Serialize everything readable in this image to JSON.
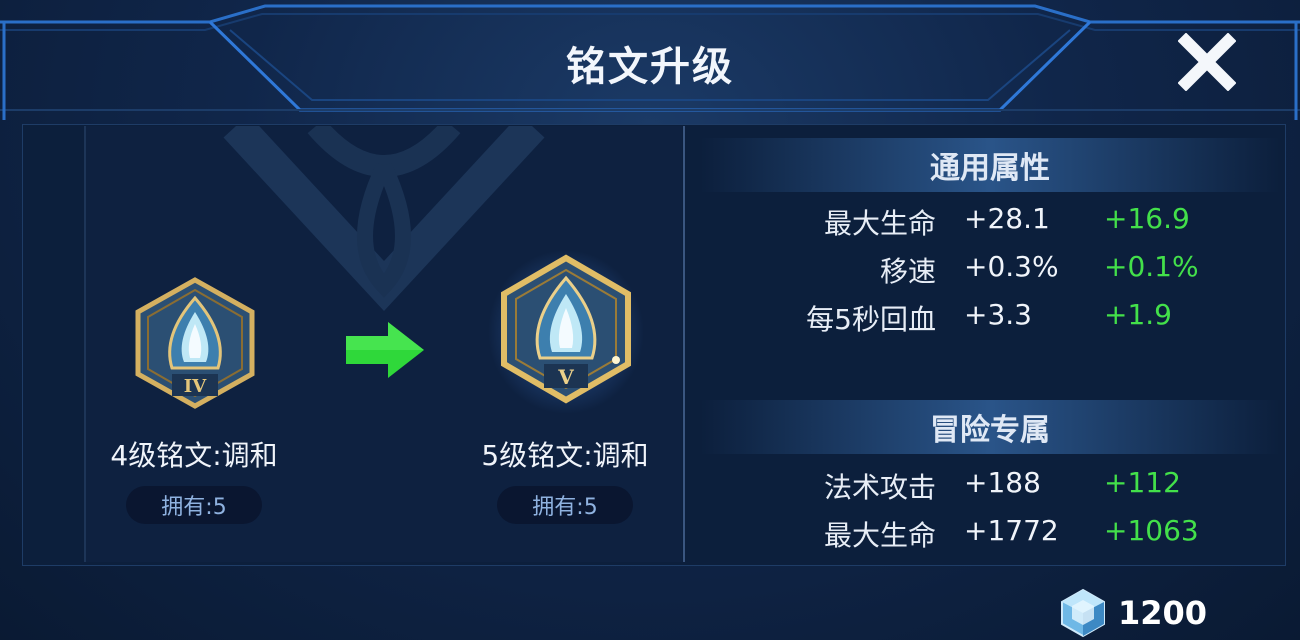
{
  "dialog": {
    "title": "铭文升级",
    "close_icon": "close-icon"
  },
  "upgrade": {
    "from": {
      "label": "4级铭文:调和",
      "owned": "拥有:5",
      "tier": "IV"
    },
    "to": {
      "label": "5级铭文:调和",
      "owned": "拥有:5",
      "tier": "V"
    },
    "arrow_color": "#2fd83a"
  },
  "stats": {
    "general": {
      "heading": "通用属性",
      "rows": [
        {
          "name": "最大生命",
          "base": "+28.1",
          "bonus": "+16.9"
        },
        {
          "name": "移速",
          "base": "+0.3%",
          "bonus": "+0.1%"
        },
        {
          "name": "每5秒回血",
          "base": "+3.3",
          "bonus": "+1.9"
        }
      ]
    },
    "adventure": {
      "heading": "冒险专属",
      "rows": [
        {
          "name": "法术攻击",
          "base": "+188",
          "bonus": "+112"
        },
        {
          "name": "最大生命",
          "base": "+1772",
          "bonus": "+1063"
        }
      ]
    }
  },
  "currency": {
    "icon": "crystal-icon",
    "amount": "1200"
  },
  "colors": {
    "bonus_green": "#43e04a",
    "frame_blue": "#2a6fc8",
    "gold": "#d4b060"
  }
}
